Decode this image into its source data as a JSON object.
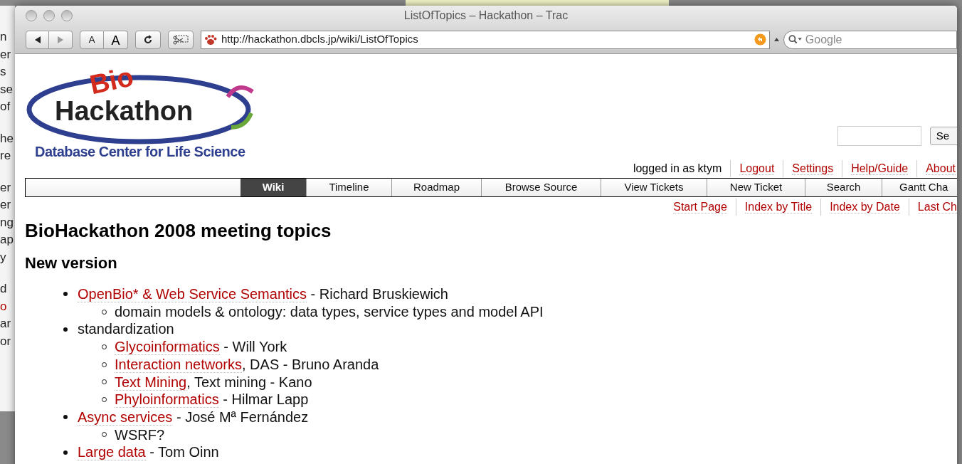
{
  "background_window": {
    "paragraphs": [
      [
        {
          "text": "n",
          "link": false
        },
        {
          "text": "er",
          "link": false
        },
        {
          "text": "s",
          "link": false
        },
        {
          "text": "se",
          "link": false
        },
        {
          "text": "of",
          "link": false
        }
      ],
      [
        {
          "text": "he",
          "link": false
        },
        {
          "text": "re",
          "link": false
        }
      ],
      [
        {
          "text": "er",
          "link": false
        },
        {
          "text": "er",
          "link": false
        },
        {
          "text": "ng",
          "link": false
        },
        {
          "text": "ap",
          "link": false
        },
        {
          "text": "y",
          "link": false
        }
      ],
      [
        {
          "text": "d",
          "link": false
        },
        {
          "text": "o",
          "link": true
        },
        {
          "text": "ar",
          "link": false
        },
        {
          "text": "or",
          "link": false
        }
      ]
    ]
  },
  "window": {
    "title": "ListOfTopics – Hackathon – Trac"
  },
  "toolbar": {
    "text_size_buttons": [
      "A",
      "A"
    ],
    "url": "http://hackathon.dbcls.jp/wiki/ListOfTopics",
    "search_placeholder": "Google"
  },
  "page": {
    "logo": {
      "bio": "Bio",
      "name": "Hackathon",
      "subtitle": "Database Center for Life Science"
    },
    "search_button": "Se",
    "metanav": [
      {
        "text": "logged in as ktym",
        "link": false
      },
      {
        "text": "Logout",
        "link": true
      },
      {
        "text": "Settings",
        "link": true
      },
      {
        "text": "Help/Guide",
        "link": true
      },
      {
        "text": "About",
        "link": true
      }
    ],
    "mainnav": [
      {
        "label": "Wiki",
        "selected": true
      },
      {
        "label": "Timeline",
        "selected": false
      },
      {
        "label": "Roadmap",
        "selected": false
      },
      {
        "label": "Browse Source",
        "selected": false
      },
      {
        "label": "View Tickets",
        "selected": false
      },
      {
        "label": "New Ticket",
        "selected": false
      },
      {
        "label": "Search",
        "selected": false
      },
      {
        "label": "Gantt Cha",
        "selected": false
      }
    ],
    "ctxtnav": [
      "Start Page",
      "Index by Title",
      "Index by Date",
      "Last Ch"
    ],
    "title": "BioHackathon 2008 meeting topics",
    "section": "New version",
    "topics": [
      {
        "parts": [
          {
            "text": "OpenBio* & Web Service Semantics",
            "link": true
          },
          {
            "text": " - Richard Bruskiewich",
            "link": false
          }
        ],
        "children": [
          {
            "parts": [
              {
                "text": "domain models & ontology: data types, service types and model API",
                "link": false
              }
            ]
          }
        ]
      },
      {
        "parts": [
          {
            "text": "standardization",
            "link": false
          }
        ],
        "children": [
          {
            "parts": [
              {
                "text": "Glycoinformatics",
                "link": true
              },
              {
                "text": " - Will York",
                "link": false
              }
            ]
          },
          {
            "parts": [
              {
                "text": "Interaction networks",
                "link": true
              },
              {
                "text": ", DAS - Bruno Aranda",
                "link": false
              }
            ]
          },
          {
            "parts": [
              {
                "text": "Text Mining",
                "link": true
              },
              {
                "text": ", Text mining - Kano",
                "link": false
              }
            ]
          },
          {
            "parts": [
              {
                "text": "Phyloinformatics",
                "link": true
              },
              {
                "text": " - Hilmar Lapp",
                "link": false
              }
            ]
          }
        ]
      },
      {
        "parts": [
          {
            "text": "Async services",
            "link": true
          },
          {
            "text": " - José Mª Fernández",
            "link": false
          }
        ],
        "children": [
          {
            "parts": [
              {
                "text": "WSRF?",
                "link": false
              }
            ]
          }
        ]
      },
      {
        "parts": [
          {
            "text": "Large data",
            "link": true
          },
          {
            "text": " - Tom Oinn",
            "link": false
          }
        ]
      }
    ]
  }
}
